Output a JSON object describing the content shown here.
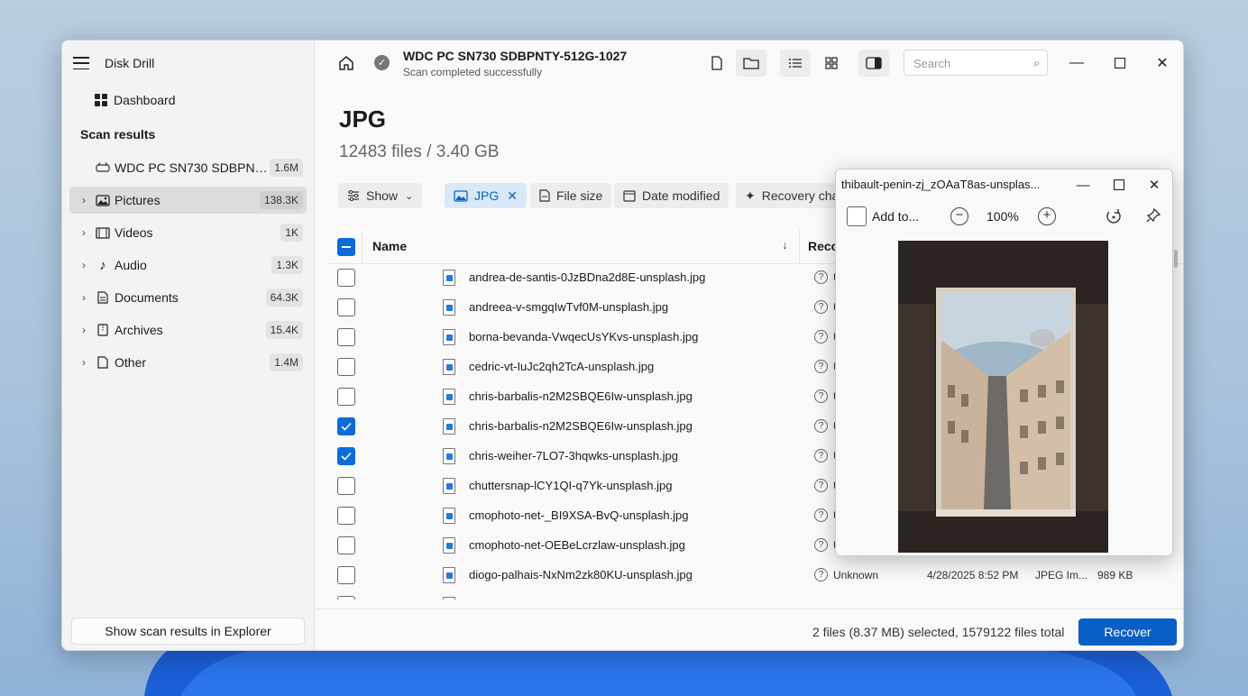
{
  "app": {
    "title": "Disk Drill"
  },
  "sidebar": {
    "dashboard_label": "Dashboard",
    "section_title": "Scan results",
    "items": [
      {
        "label": "WDC PC SN730 SDBPNTY...",
        "count": "1.6M"
      },
      {
        "label": "Pictures",
        "count": "138.3K"
      },
      {
        "label": "Videos",
        "count": "1K"
      },
      {
        "label": "Audio",
        "count": "1.3K"
      },
      {
        "label": "Documents",
        "count": "64.3K"
      },
      {
        "label": "Archives",
        "count": "15.4K"
      },
      {
        "label": "Other",
        "count": "1.4M"
      }
    ],
    "footer_button": "Show scan results in Explorer"
  },
  "header": {
    "device_title": "WDC PC SN730 SDBPNTY-512G-1027",
    "device_status": "Scan completed successfully",
    "search_placeholder": "Search"
  },
  "main": {
    "title": "JPG",
    "subtitle": "12483 files / 3.40 GB",
    "filters": {
      "show": "Show",
      "jpg": "JPG",
      "file_size": "File size",
      "date_modified": "Date modified",
      "recovery_chances": "Recovery cha"
    },
    "columns": {
      "name": "Name",
      "recovery": "Reco"
    },
    "rows": [
      {
        "name": "andrea-de-santis-0JzBDna2d8E-unsplash.jpg",
        "checked": false,
        "status": "U"
      },
      {
        "name": "andreea-v-smgqIwTvf0M-unsplash.jpg",
        "checked": false,
        "status": "U"
      },
      {
        "name": "borna-bevanda-VwqecUsYKvs-unsplash.jpg",
        "checked": false,
        "status": "U"
      },
      {
        "name": "cedric-vt-IuJc2qh2TcA-unsplash.jpg",
        "checked": false,
        "status": "U"
      },
      {
        "name": "chris-barbalis-n2M2SBQE6Iw-unsplash.jpg",
        "checked": false,
        "status": "U"
      },
      {
        "name": "chris-barbalis-n2M2SBQE6Iw-unsplash.jpg",
        "checked": true,
        "status": "U"
      },
      {
        "name": "chris-weiher-7LO7-3hqwks-unsplash.jpg",
        "checked": true,
        "status": "U"
      },
      {
        "name": "chuttersnap-lCY1QI-q7Yk-unsplash.jpg",
        "checked": false,
        "status": "U"
      },
      {
        "name": "cmophoto-net-_BI9XSA-BvQ-unsplash.jpg",
        "checked": false,
        "status": "U"
      },
      {
        "name": "cmophoto-net-OEBeLcrzlaw-unsplash.jpg",
        "checked": false,
        "status": "U"
      },
      {
        "name": "diogo-palhais-NxNm2zk80KU-unsplash.jpg",
        "checked": false,
        "status": "Unknown",
        "date": "4/28/2025 8:52 PM",
        "kind": "JPEG Im...",
        "size": "989 KB"
      }
    ],
    "selection_summary": "2 files (8.37 MB) selected, 1579122 files total",
    "recover_button": "Recover"
  },
  "preview": {
    "title": "thibault-penin-zj_zOAaT8as-unsplas...",
    "add_to": "Add to...",
    "zoom": "100%"
  },
  "colors": {
    "accent": "#0a5fc7",
    "checkbox": "#0a6cd8",
    "sidebar_bg": "#f3f3f3",
    "chip_selected": "#d9e8f7"
  }
}
